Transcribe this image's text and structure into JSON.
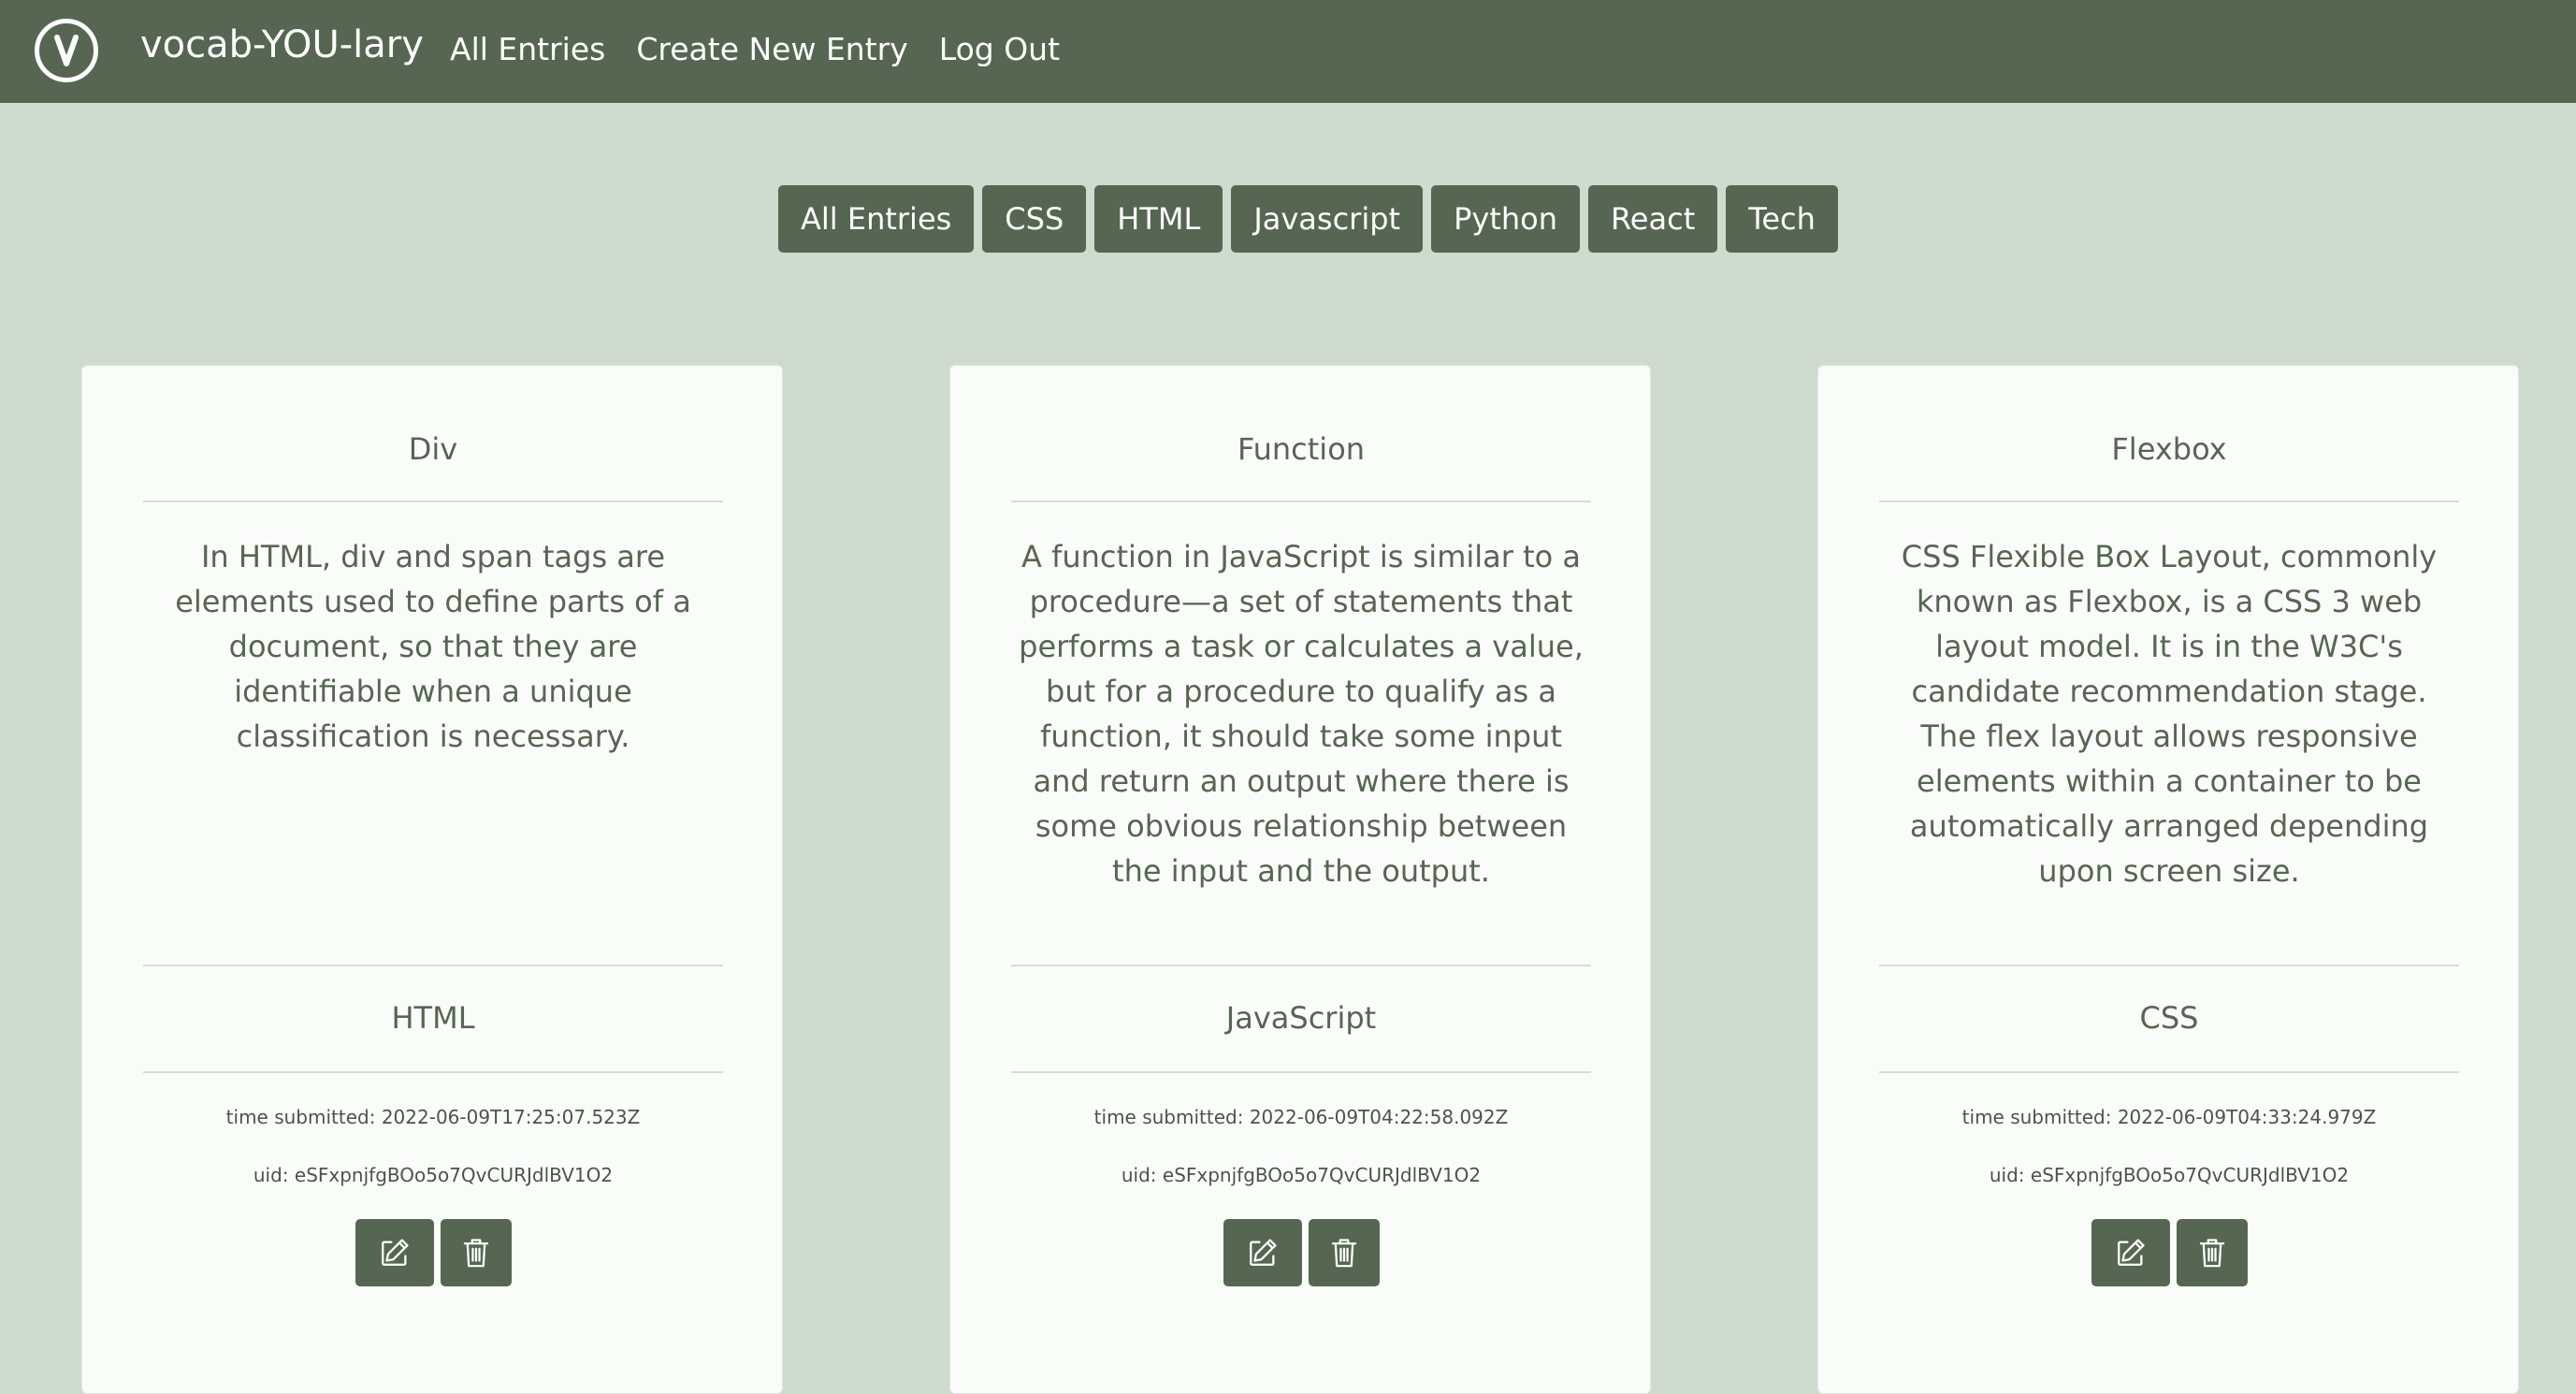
{
  "navbar": {
    "brand": "vocab-YOU-lary",
    "logo_icon": "v-circle-logo",
    "links": [
      "All Entries",
      "Create New Entry",
      "Log Out"
    ]
  },
  "filters": [
    "All Entries",
    "CSS",
    "HTML",
    "Javascript",
    "Python",
    "React",
    "Tech"
  ],
  "cards": [
    {
      "title": "Div",
      "description": "In HTML, div and span tags are elements used to define parts of a document, so that they are identifiable when a unique classification is necessary.",
      "category": "HTML",
      "time": "time submitted: 2022-06-09T17:25:07.523Z",
      "uid": "uid: eSFxpnjfgBOo5o7QvCURJdlBV1O2"
    },
    {
      "title": "Function",
      "description": "A function in JavaScript is similar to a procedure—a set of statements that performs a task or calculates a value, but for a procedure to qualify as a function, it should take some input and return an output where there is some obvious relationship between the input and the output.",
      "category": "JavaScript",
      "time": "time submitted: 2022-06-09T04:22:58.092Z",
      "uid": "uid: eSFxpnjfgBOo5o7QvCURJdlBV1O2"
    },
    {
      "title": "Flexbox",
      "description": "CSS Flexible Box Layout, commonly known as Flexbox, is a CSS 3 web layout model. It is in the W3C's candidate recommendation stage. The flex layout allows responsive elements within a container to be automatically arranged depending upon screen size.",
      "category": "CSS",
      "time": "time submitted: 2022-06-09T04:33:24.979Z",
      "uid": "uid: eSFxpnjfgBOo5o7QvCURJdlBV1O2"
    }
  ],
  "colors": {
    "primary": "#566652",
    "background": "#cfdbcf",
    "card": "#fafcfa",
    "text_on_primary": "#ffffff"
  },
  "icons": {
    "edit": "edit-icon",
    "delete": "trash-icon"
  }
}
